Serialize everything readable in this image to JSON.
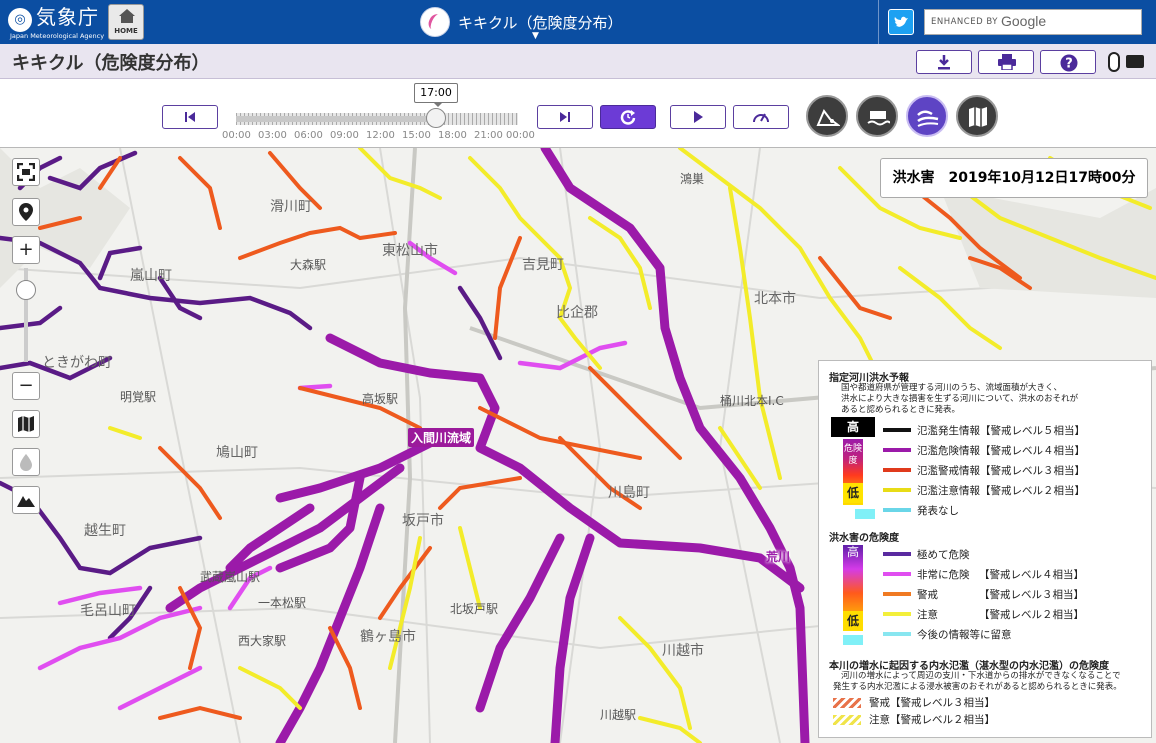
{
  "header": {
    "agency_name": "気象庁",
    "agency_name_en": "Japan Meteorological Agency",
    "agency_mark": "JMA",
    "home_label": "HOME",
    "app_name": "キキクル（危険度分布）",
    "search_prefix": "ENHANCED BY",
    "search_brand": "Google"
  },
  "title_bar": {
    "title": "キキクル（危険度分布）",
    "buttons": [
      {
        "name": "download",
        "icon": "download-icon"
      },
      {
        "name": "print",
        "icon": "print-icon"
      },
      {
        "name": "help",
        "icon": "help-icon"
      }
    ],
    "input_modes": [
      "mouse-icon",
      "keyboard-icon"
    ]
  },
  "timeline": {
    "current_time": "17:00",
    "ticks": [
      "00:00",
      "03:00",
      "06:00",
      "09:00",
      "12:00",
      "15:00",
      "18:00",
      "21:00",
      "00:00"
    ],
    "controls": [
      "first-icon",
      "last-icon",
      "latest-icon",
      "play-icon",
      "speed-icon"
    ],
    "active_control": "latest-icon",
    "layers": [
      {
        "name": "landslide-layer",
        "icon": "landslide-icon",
        "active": false
      },
      {
        "name": "inundation-layer",
        "icon": "inundation-icon",
        "active": false
      },
      {
        "name": "flood-layer",
        "icon": "flood-icon",
        "active": true
      },
      {
        "name": "map-layer",
        "icon": "map-icon",
        "active": false
      }
    ]
  },
  "map": {
    "date_label": "洪水害　2019年10月12日17時00分",
    "places": [
      {
        "label": "滑川町"
      },
      {
        "label": "東松山市"
      },
      {
        "label": "吉見町"
      },
      {
        "label": "嵐山町"
      },
      {
        "label": "比企郡"
      },
      {
        "label": "ときがわ町"
      },
      {
        "label": "北本市"
      },
      {
        "label": "鴻巣"
      },
      {
        "label": "坂戸市"
      },
      {
        "label": "川島町"
      },
      {
        "label": "越生町"
      },
      {
        "label": "毛呂山町"
      },
      {
        "label": "鶴ヶ島市"
      },
      {
        "label": "川越市"
      },
      {
        "label": "桶川北本I.C"
      },
      {
        "label": "明覚駅"
      },
      {
        "label": "高坂駅"
      },
      {
        "label": "大森駅"
      },
      {
        "label": "西大家駅"
      },
      {
        "label": "一本松駅"
      },
      {
        "label": "武蔵嵐山駅"
      },
      {
        "label": "鳩山町"
      },
      {
        "label": "北坂戸駅"
      },
      {
        "label": "川越駅"
      }
    ],
    "river_labels": [
      "入間川流域",
      "荒川"
    ],
    "colors": {
      "level5": "#111111",
      "level4": "#9b1aa9",
      "level3": "#ee4e1e",
      "level2": "#f0e91c",
      "none": "#6ad6e8",
      "extreme": "#6a1b9a",
      "very_high": "#e04ef0",
      "warning": "#f07a22",
      "caution": "#f3ef3a",
      "advisory": "#88e6f0",
      "map_bg": "#f2f2ef"
    }
  },
  "legend": {
    "section1_title": "指定河川洪水予報",
    "section1_note": [
      "国や都道府県が管理する河川のうち、流域面積が大きく、",
      "洪水により大きな損害を生ずる河川について、洪水のおそれが",
      "あると認められるときに発表。"
    ],
    "scale1": {
      "high": "高",
      "middle": "危険度",
      "low": "低"
    },
    "section1_items": [
      {
        "label": "氾濫発生情報【警戒レベル５相当】",
        "color": "#111111"
      },
      {
        "label": "氾濫危険情報【警戒レベル４相当】",
        "color": "#9b1aa9"
      },
      {
        "label": "氾濫警戒情報【警戒レベル３相当】",
        "color": "#e03a1c"
      },
      {
        "label": "氾濫注意情報【警戒レベル２相当】",
        "color": "#e8dc16"
      },
      {
        "label": "発表なし",
        "color": "#6ad6e8"
      }
    ],
    "section2_title": "洪水害の危険度",
    "scale2": {
      "high": "高",
      "middle": "危険度",
      "low": "低"
    },
    "section2_items": [
      {
        "label": "極めて危険",
        "level": "",
        "color": "#5a2aa0"
      },
      {
        "label": "非常に危険",
        "level": "【警戒レベル４相当】",
        "color": "#e04ef0"
      },
      {
        "label": "警戒",
        "level": "【警戒レベル３相当】",
        "color": "#f07a22"
      },
      {
        "label": "注意",
        "level": "【警戒レベル２相当】",
        "color": "#f3ef3a"
      },
      {
        "label": "今後の情報等に留意",
        "level": "",
        "color": "#88e6f0"
      }
    ],
    "section3_title": "本川の増水に起因する内水氾濫（湛水型の内水氾濫）の危険度",
    "section3_note": [
      "河川の増水によって周辺の支川・下水道からの排水ができなくなることで",
      "発生する内水氾濫による浸水被害のおそれがあると認められるときに発表。"
    ],
    "section3_items": [
      {
        "label": "警戒【警戒レベル３相当】",
        "color": "#e8734a"
      },
      {
        "label": "注意【警戒レベル２相当】",
        "color": "#f0e44a"
      }
    ]
  }
}
